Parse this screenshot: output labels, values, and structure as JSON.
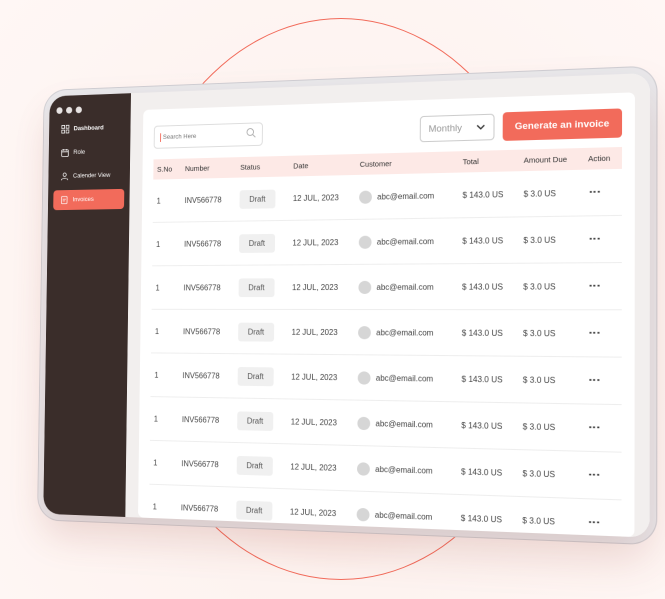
{
  "sidebar": {
    "items": [
      {
        "label": "Dashboard",
        "icon": "grid-icon"
      },
      {
        "label": "Role",
        "icon": "calendar-icon"
      },
      {
        "label": "Calender View",
        "icon": "users-icon"
      },
      {
        "label": "Invoices",
        "icon": "invoice-icon"
      }
    ]
  },
  "search": {
    "placeholder": "Search Here"
  },
  "filter": {
    "value": "Monthly"
  },
  "actions": {
    "generate_label": "Generate an invoice"
  },
  "table": {
    "headers": [
      "S.No",
      "Number",
      "Status",
      "Date",
      "Customer",
      "Total",
      "Amount Due",
      "Action"
    ],
    "rows": [
      {
        "sno": "1",
        "number": "INV566778",
        "status": "Draft",
        "date": "12 JUL, 2023",
        "customer": "abc@email.com",
        "total": "$ 143.0 US",
        "due": "$ 3.0 US"
      },
      {
        "sno": "1",
        "number": "INV566778",
        "status": "Draft",
        "date": "12 JUL, 2023",
        "customer": "abc@email.com",
        "total": "$ 143.0 US",
        "due": "$ 3.0 US"
      },
      {
        "sno": "1",
        "number": "INV566778",
        "status": "Draft",
        "date": "12 JUL, 2023",
        "customer": "abc@email.com",
        "total": "$ 143.0 US",
        "due": "$ 3.0 US"
      },
      {
        "sno": "1",
        "number": "INV566778",
        "status": "Draft",
        "date": "12 JUL, 2023",
        "customer": "abc@email.com",
        "total": "$ 143.0 US",
        "due": "$ 3.0 US"
      },
      {
        "sno": "1",
        "number": "INV566778",
        "status": "Draft",
        "date": "12 JUL, 2023",
        "customer": "abc@email.com",
        "total": "$ 143.0 US",
        "due": "$ 3.0 US"
      },
      {
        "sno": "1",
        "number": "INV566778",
        "status": "Draft",
        "date": "12 JUL, 2023",
        "customer": "abc@email.com",
        "total": "$ 143.0 US",
        "due": "$ 3.0 US"
      },
      {
        "sno": "1",
        "number": "INV566778",
        "status": "Draft",
        "date": "12 JUL, 2023",
        "customer": "abc@email.com",
        "total": "$ 143.0 US",
        "due": "$ 3.0 US"
      },
      {
        "sno": "1",
        "number": "INV566778",
        "status": "Draft",
        "date": "12 JUL, 2023",
        "customer": "abc@email.com",
        "total": "$ 143.0 US",
        "due": "$ 3.0 US"
      }
    ]
  },
  "colors": {
    "accent": "#f26b5b",
    "sidebar": "#3a2d2a"
  }
}
